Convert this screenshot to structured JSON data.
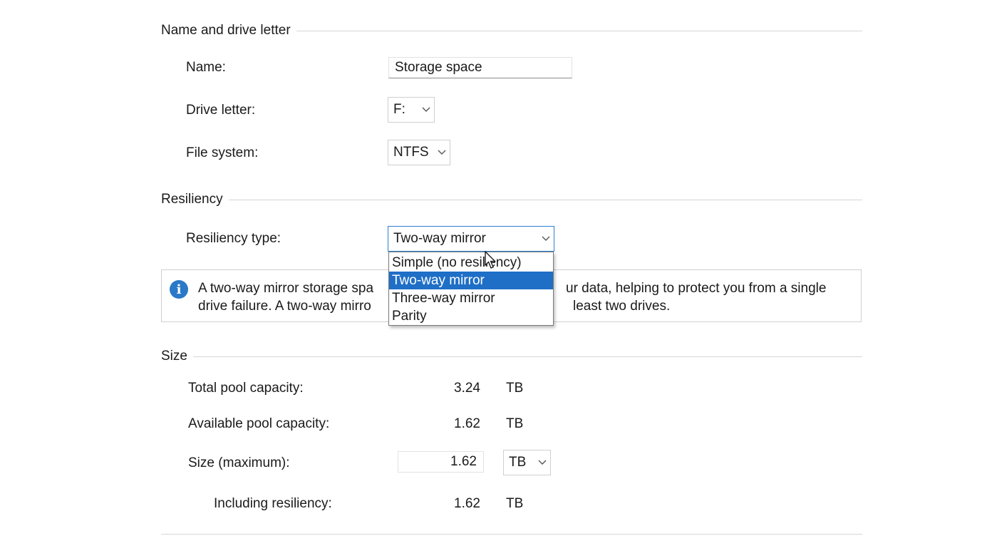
{
  "name_section": {
    "header": "Name and drive letter",
    "name_label": "Name:",
    "name_value": "Storage space",
    "drive_letter_label": "Drive letter:",
    "drive_letter_value": "F:",
    "file_system_label": "File system:",
    "file_system_value": "NTFS"
  },
  "resiliency_section": {
    "header": "Resiliency",
    "type_label": "Resiliency type:",
    "type_value": "Two-way mirror",
    "options": [
      "Simple (no resiliency)",
      "Two-way mirror",
      "Three-way mirror",
      "Parity"
    ],
    "selected_index": 1,
    "info_line1_start": "A two-way mirror storage spa",
    "info_line1_end": "ur data, helping to protect you from a single",
    "info_line2_start": "drive failure. A two-way mirro",
    "info_line2_end": "least two drives."
  },
  "size_section": {
    "header": "Size",
    "total_label": "Total pool capacity:",
    "total_value": "3.24",
    "total_unit": "TB",
    "available_label": "Available pool capacity:",
    "available_value": "1.62",
    "available_unit": "TB",
    "size_label": "Size (maximum):",
    "size_value": "1.62",
    "size_unit": "TB",
    "including_label": "Including resiliency:",
    "including_value": "1.62",
    "including_unit": "TB"
  },
  "colors": {
    "accent": "#1f6fc7",
    "info_icon": "#2a78c8",
    "divider": "#d6d6d6"
  }
}
